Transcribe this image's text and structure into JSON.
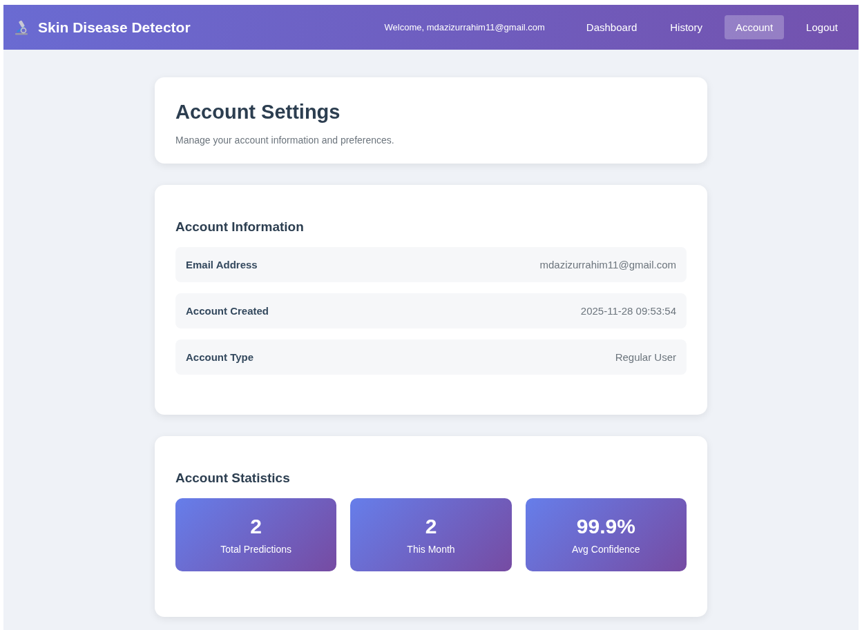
{
  "navbar": {
    "brand": "Skin Disease Detector",
    "welcome": "Welcome, mdazizurrahim11@gmail.com",
    "links": [
      {
        "label": "Dashboard",
        "selected": false
      },
      {
        "label": "History",
        "selected": false
      },
      {
        "label": "Account",
        "selected": true
      },
      {
        "label": "Logout",
        "selected": false
      }
    ]
  },
  "header": {
    "title": "Account Settings",
    "subtitle": "Manage your account information and preferences."
  },
  "account_information": {
    "title": "Account Information",
    "rows": [
      {
        "label": "Email Address",
        "value": "mdazizurrahim11@gmail.com"
      },
      {
        "label": "Account Created",
        "value": "2025-11-28 09:53:54"
      },
      {
        "label": "Account Type",
        "value": "Regular User"
      }
    ]
  },
  "account_statistics": {
    "title": "Account Statistics",
    "stats": [
      {
        "value": "2",
        "label": "Total Predictions"
      },
      {
        "value": "2",
        "label": "This Month"
      },
      {
        "value": "99.9%",
        "label": "Avg Confidence"
      }
    ]
  }
}
